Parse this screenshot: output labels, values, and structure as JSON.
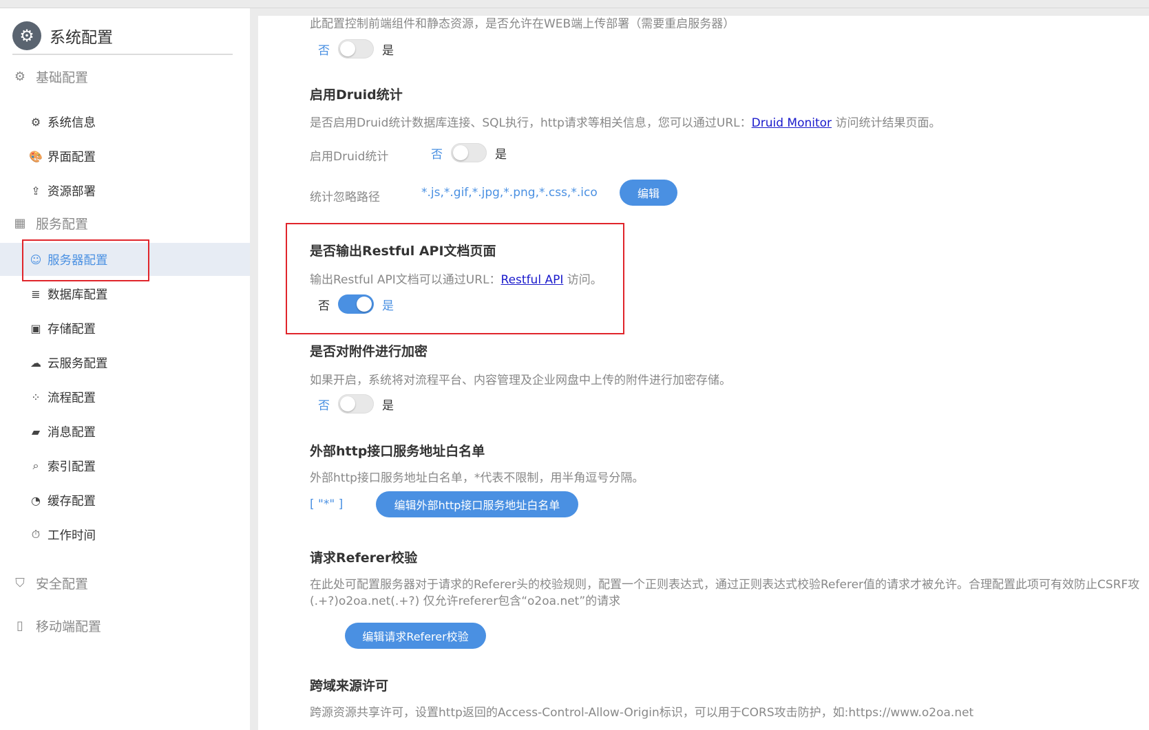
{
  "sidebar": {
    "title": "系统配置",
    "groups": [
      {
        "label": "基础配置"
      },
      {
        "label": "服务配置"
      },
      {
        "label": "安全配置"
      },
      {
        "label": "移动端配置"
      }
    ],
    "items": [
      {
        "label": "系统信息"
      },
      {
        "label": "界面配置"
      },
      {
        "label": "资源部署"
      },
      {
        "label": "服务器配置"
      },
      {
        "label": "数据库配置"
      },
      {
        "label": "存储配置"
      },
      {
        "label": "云服务配置"
      },
      {
        "label": "流程配置"
      },
      {
        "label": "消息配置"
      },
      {
        "label": "索引配置"
      },
      {
        "label": "缓存配置"
      },
      {
        "label": "工作时间"
      }
    ],
    "active_item": "服务器配置"
  },
  "main": {
    "top_desc": "此配置控制前端组件和静态资源，是否允许在WEB端上传部署（需要重启服务器）",
    "toggle_no": "否",
    "toggle_yes": "是",
    "top_toggle_on": false,
    "druid": {
      "title": "启用Druid统计",
      "desc_prefix": "是否启用Druid统计数据库连接、SQL执行，http请求等相关信息，您可以通过URL：",
      "link": "Druid Monitor",
      "desc_suffix": "访问统计结果页面。",
      "toggle_label": "启用Druid统计",
      "toggle_on": false,
      "ignore_label": "统计忽略路径",
      "ignore_value": "*.js,*.gif,*.jpg,*.png,*.css,*.ico",
      "edit_button": "编辑"
    },
    "restful": {
      "title": "是否输出Restful API文档页面",
      "desc_prefix": "输出Restful API文档可以通过URL：",
      "link": "Restful API",
      "desc_suffix": "访问。",
      "toggle_on": true
    },
    "encrypt": {
      "title": "是否对附件进行加密",
      "desc": "如果开启，系统将对流程平台、内容管理及企业网盘中上传的附件进行加密存储。",
      "toggle_on": false
    },
    "whitelist": {
      "title": "外部http接口服务地址白名单",
      "desc": "外部http接口服务地址白名单，*代表不限制，用半角逗号分隔。",
      "value": "[ \"*\" ]",
      "button": "编辑外部http接口服务地址白名单"
    },
    "referer": {
      "title": "请求Referer校验",
      "desc_line1": "在此处可配置服务器对于请求的Referer头的校验规则，配置一个正则表达式，通过正则表达式校验Referer值的请求才被允许。合理配置此项可有效防止CSRF攻",
      "desc_line2": "(.+?)o2oa.net(.+?) 仅允许referer包含“o2oa.net”的请求",
      "button": "编辑请求Referer校验"
    },
    "cors": {
      "title": "跨域来源许可",
      "desc": "跨源资源共享许可，设置http返回的Access-Control-Allow-Origin标识，可以用于CORS攻击防护，如:https://www.o2oa.net"
    }
  },
  "colors": {
    "accent": "#4a90e2",
    "highlight_box": "#e0242a"
  }
}
